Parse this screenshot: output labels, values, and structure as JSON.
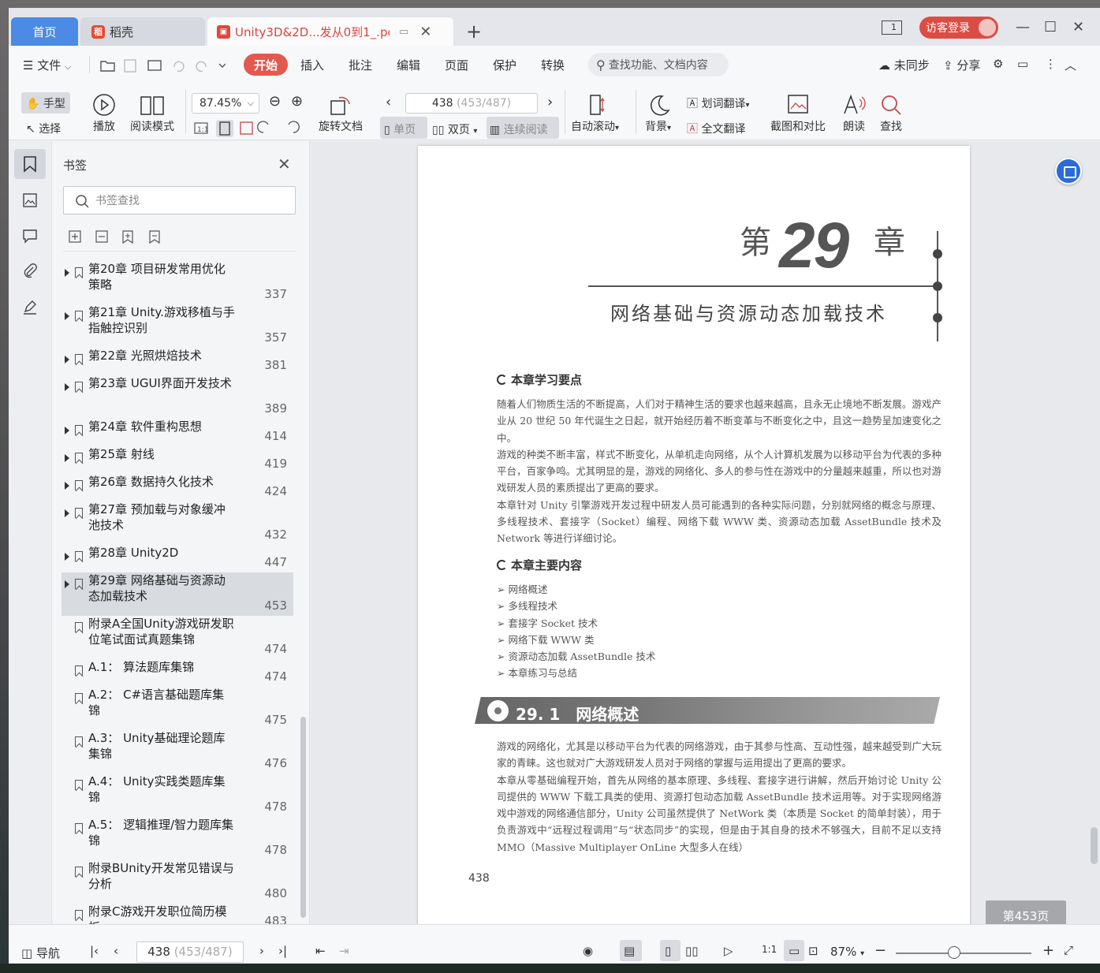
{
  "titlebar": {
    "tabs": [
      {
        "label": "首页"
      },
      {
        "label": "稻壳",
        "logo": "稻"
      },
      {
        "label": "Unity3D&2D...发从0到1_.pdf"
      }
    ],
    "page_count_badge": "1",
    "login_label": "访客登录"
  },
  "menubar": {
    "file": "文件",
    "items": [
      "开始",
      "插入",
      "批注",
      "编辑",
      "页面",
      "保护",
      "转换"
    ],
    "search_placeholder": "查找功能、文档内容",
    "sync": "未同步",
    "share": "分享"
  },
  "toolbar": {
    "hand": "手型",
    "select": "选择",
    "play": "播放",
    "read_mode": "阅读模式",
    "zoom": "87.45%",
    "rotate": "旋转文档",
    "page_current": "438",
    "page_total": "(453/487)",
    "single": "单页",
    "double": "双页",
    "continuous": "连续阅读",
    "autoscroll": "自动滚动",
    "background": "背景",
    "word_translate": "划词翻译",
    "full_translate": "全文翻译",
    "screenshot": "截图和对比",
    "read_aloud": "朗读",
    "find": "查找"
  },
  "bookmarks": {
    "title": "书签",
    "search_placeholder": "书签查找",
    "items": [
      {
        "text": "第20章 项目研发常用优化策略",
        "page": "337",
        "expandable": true
      },
      {
        "text": "第21章 Unity.游戏移植与手指触控识别",
        "page": "357",
        "expandable": true
      },
      {
        "text": "第22章 光照烘焙技术",
        "page": "381",
        "expandable": true
      },
      {
        "text": "第23章 UGUI界面开发技术",
        "page": "389",
        "expandable": true
      },
      {
        "text": "第24章 软件重构思想",
        "page": "414",
        "expandable": true
      },
      {
        "text": "第25章 射线",
        "page": "419",
        "expandable": true
      },
      {
        "text": "第26章 数据持久化技术",
        "page": "424",
        "expandable": true
      },
      {
        "text": "第27章 预加载与对象缓冲池技术",
        "page": "432",
        "expandable": true
      },
      {
        "text": "第28章 Unity2D",
        "page": "447",
        "expandable": true
      },
      {
        "text": "第29章 网络基础与资源动态加载技术",
        "page": "453",
        "expandable": true,
        "selected": true
      },
      {
        "text": "附录A全国Unity游戏研发职位笔试面试真题集锦",
        "page": "474",
        "expandable": false
      },
      {
        "text": "A.1： 算法题库集锦",
        "page": "474",
        "expandable": false
      },
      {
        "text": "A.2： C#语言基础题库集锦",
        "page": "475",
        "expandable": false
      },
      {
        "text": "A.3： Unity基础理论题库集锦",
        "page": "476",
        "expandable": false
      },
      {
        "text": "A.4： Unity实践类题库集锦",
        "page": "478",
        "expandable": false
      },
      {
        "text": "A.5： 逻辑推理/智力题库集锦",
        "page": "478",
        "expandable": false
      },
      {
        "text": "附录BUnity开发常见错误与分析",
        "page": "480",
        "expandable": false
      },
      {
        "text": "附录C游戏开发职位简历模板",
        "page": "483",
        "expandable": false
      }
    ]
  },
  "document": {
    "chapter_prefix": "第",
    "chapter_number": "29",
    "chapter_suffix": "章",
    "chapter_title": "网络基础与资源动态加载技术",
    "key_points_heading": "本章学习要点",
    "key_points_paras": [
      "随着人们物质生活的不断提高，人们对于精神生活的要求也越来越高，且永无止境地不断发展。游戏产业从 20 世纪 50 年代诞生之日起，就开始经历着不断变革与不断变化之中，且这一趋势呈加速变化之中。",
      "游戏的种类不断丰富，样式不断变化，从单机走向网络，从个人计算机发展为以移动平台为代表的多种平台，百家争鸣。尤其明显的是，游戏的网络化、多人的参与性在游戏中的分量越来越重，所以也对游戏研发人员的素质提出了更高的要求。",
      "本章针对 Unity 引擎游戏开发过程中研发人员可能遇到的各种实际问题，分别就网络的概念与原理、多线程技术、套接字（Socket）编程、网络下载 WWW 类、资源动态加载 AssetBundle 技术及 Network 等进行详细讨论。"
    ],
    "content_heading": "本章主要内容",
    "toc": [
      "网络概述",
      "多线程技术",
      "套接字 Socket 技术",
      "网络下载 WWW 类",
      "资源动态加载 AssetBundle 技术",
      "本章练习与总结"
    ],
    "section_number": "29. 1",
    "section_title": "网络概述",
    "body_paras": [
      "游戏的网络化，尤其是以移动平台为代表的网络游戏，由于其参与性高、互动性强，越来越受到广大玩家的青睐。这也就对广大游戏研发人员对于网络的掌握与运用提出了更高的要求。",
      "本章从零基础编程开始，首先从网络的基本原理、多线程、套接字进行讲解，然后开始讨论 Unity 公司提供的 WWW 下载工具类的使用、资源打包动态加载 AssetBundle 技术运用等。对于实现网络游戏中游戏的网络通信部分，Unity 公司虽然提供了 NetWork 类（本质是 Socket 的简单封装），用于负责游戏中“远程过程调用”与“状态同步”的实现，但是由于其自身的技术不够强大，目前不足以支持 MMO（Massive Multiplayer OnLine 大型多人在线）"
    ],
    "page_number": "438",
    "page_indicator": "第453页"
  },
  "statusbar": {
    "nav": "导航",
    "page_current": "438",
    "page_total": "(453/487)",
    "zoom": "87%"
  },
  "colors": {
    "accent": "#e25a4e",
    "home_tab": "#4b8ae5",
    "login": "#dd4c44"
  }
}
